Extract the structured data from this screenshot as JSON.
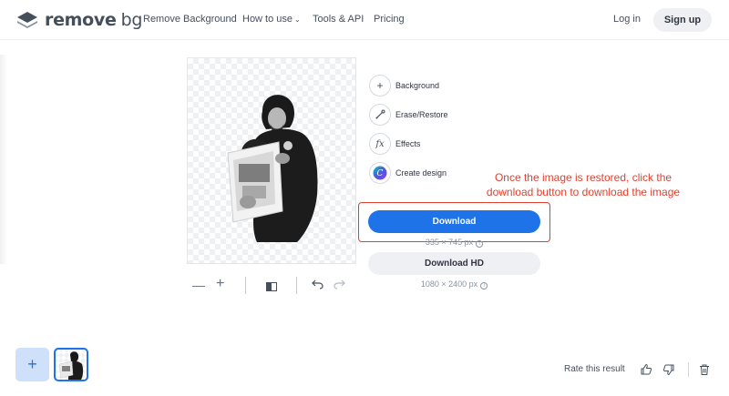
{
  "header": {
    "logo_text": "remove",
    "logo_suffix": "bg",
    "nav": [
      "Remove Background",
      "How to use",
      "Tools & API",
      "Pricing"
    ],
    "login": "Log in",
    "signup": "Sign up"
  },
  "toolbar": {
    "zoom_out": "—",
    "zoom_in": "+"
  },
  "options": {
    "background": "Background",
    "erase_restore": "Erase/Restore",
    "effects": "Effects",
    "create_design": "Create design",
    "effects_glyph": "fx"
  },
  "annotation": "Once the image is restored, click the download button to download the image",
  "download": {
    "label": "Download",
    "resolution": "335 × 745 px",
    "hd_label": "Download HD",
    "hd_resolution": "1080 × 2400 px"
  },
  "bottom": {
    "add": "+",
    "rate": "Rate this result"
  },
  "colors": {
    "accent": "#1f73e8",
    "annotation": "#e0412f"
  }
}
